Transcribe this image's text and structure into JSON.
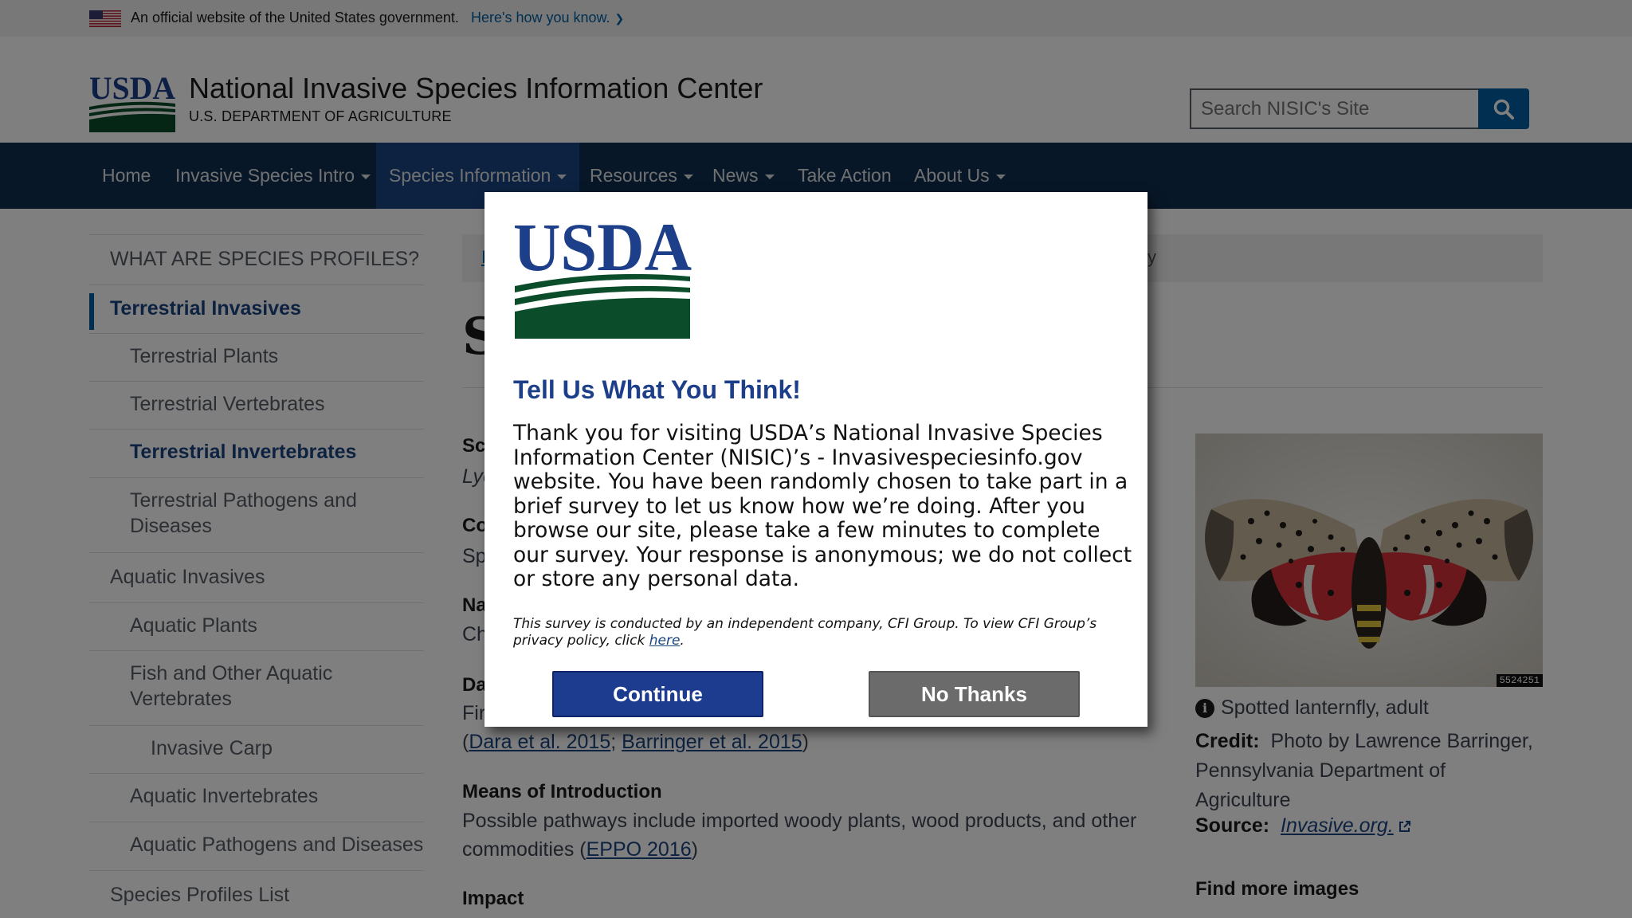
{
  "gov_banner": {
    "text": "An official website of the United States government.",
    "link": "Here's how you know."
  },
  "header": {
    "title": "National Invasive Species Information Center",
    "subtitle": "U.S. DEPARTMENT OF AGRICULTURE",
    "search_placeholder": "Search NISIC's Site"
  },
  "nav": {
    "items": [
      {
        "label": "Home",
        "dropdown": false
      },
      {
        "label": "Invasive Species Intro",
        "dropdown": true
      },
      {
        "label": "Species Information",
        "dropdown": true,
        "active": true
      },
      {
        "label": "Resources",
        "dropdown": true
      },
      {
        "label": "News",
        "dropdown": true
      },
      {
        "label": "Take Action",
        "dropdown": false
      },
      {
        "label": "About Us",
        "dropdown": true
      }
    ]
  },
  "sidebar": {
    "items": [
      {
        "label": "WHAT ARE SPECIES PROFILES?"
      },
      {
        "label": "Terrestrial Invasives"
      },
      {
        "label": "Terrestrial Plants"
      },
      {
        "label": "Terrestrial Vertebrates"
      },
      {
        "label": "Terrestrial Invertebrates"
      },
      {
        "label": "Terrestrial Pathogens and Diseases"
      },
      {
        "label": "Aquatic Invasives"
      },
      {
        "label": "Aquatic Plants"
      },
      {
        "label": "Fish and Other Aquatic Vertebrates"
      },
      {
        "label": "Invasive Carp"
      },
      {
        "label": "Aquatic Invertebrates"
      },
      {
        "label": "Aquatic Pathogens and Diseases"
      },
      {
        "label": "Species Profiles List"
      }
    ]
  },
  "main": {
    "breadcrumb_first": "I",
    "breadcrumb_tail": "y",
    "title_partial": "S",
    "fields": [
      {
        "label": "Sc",
        "value": "Lyc"
      },
      {
        "label": "Co",
        "value": "Sp"
      },
      {
        "label": "Na",
        "value": "Ch"
      },
      {
        "label": "Da",
        "value": "Fir"
      }
    ],
    "date_refs": [
      "Dara et al. 2015",
      "Barringer et al. 2015"
    ],
    "means_label": "Means of Introduction",
    "means_text": "Possible pathways include imported woody plants, wood products, and other commodities (",
    "means_ref": "EPPO 2016",
    "impact_label": "Impact"
  },
  "image_panel": {
    "image_id": "5524251",
    "caption": "Spotted lanternfly, adult",
    "credit_label": "Credit:",
    "credit_text": "Photo by Lawrence Barringer, Pennsylvania Department of Agriculture",
    "source_label": "Source:",
    "source_link": "Invasive.org.",
    "find_more": "Find more images"
  },
  "modal": {
    "heading": "Tell Us What You Think!",
    "body": "Thank you for visiting USDA’s National Invasive Species Information Center (NISIC)’s - Invasivespeciesinfo.gov website. You have been randomly chosen to take part in a brief survey to let us know how we’re doing. After you browse our site, please take a few minutes to complete our survey. Your response is anonymous; we do not collect or store any personal data.",
    "fine_print": "This survey is conducted by an independent company, CFI Group. To view CFI Group’s privacy policy, click ",
    "fine_link": "here",
    "fine_end": ".",
    "continue_label": "Continue",
    "no_thanks_label": "No Thanks"
  },
  "colors": {
    "nav_bg": "#112e51",
    "nav_active": "#1a4480",
    "usda_blue": "#1d3f8a",
    "usda_green": "#0b4d2a",
    "continue_btn": "#1d3b8f",
    "no_thanks_btn": "#6b6b6b"
  }
}
